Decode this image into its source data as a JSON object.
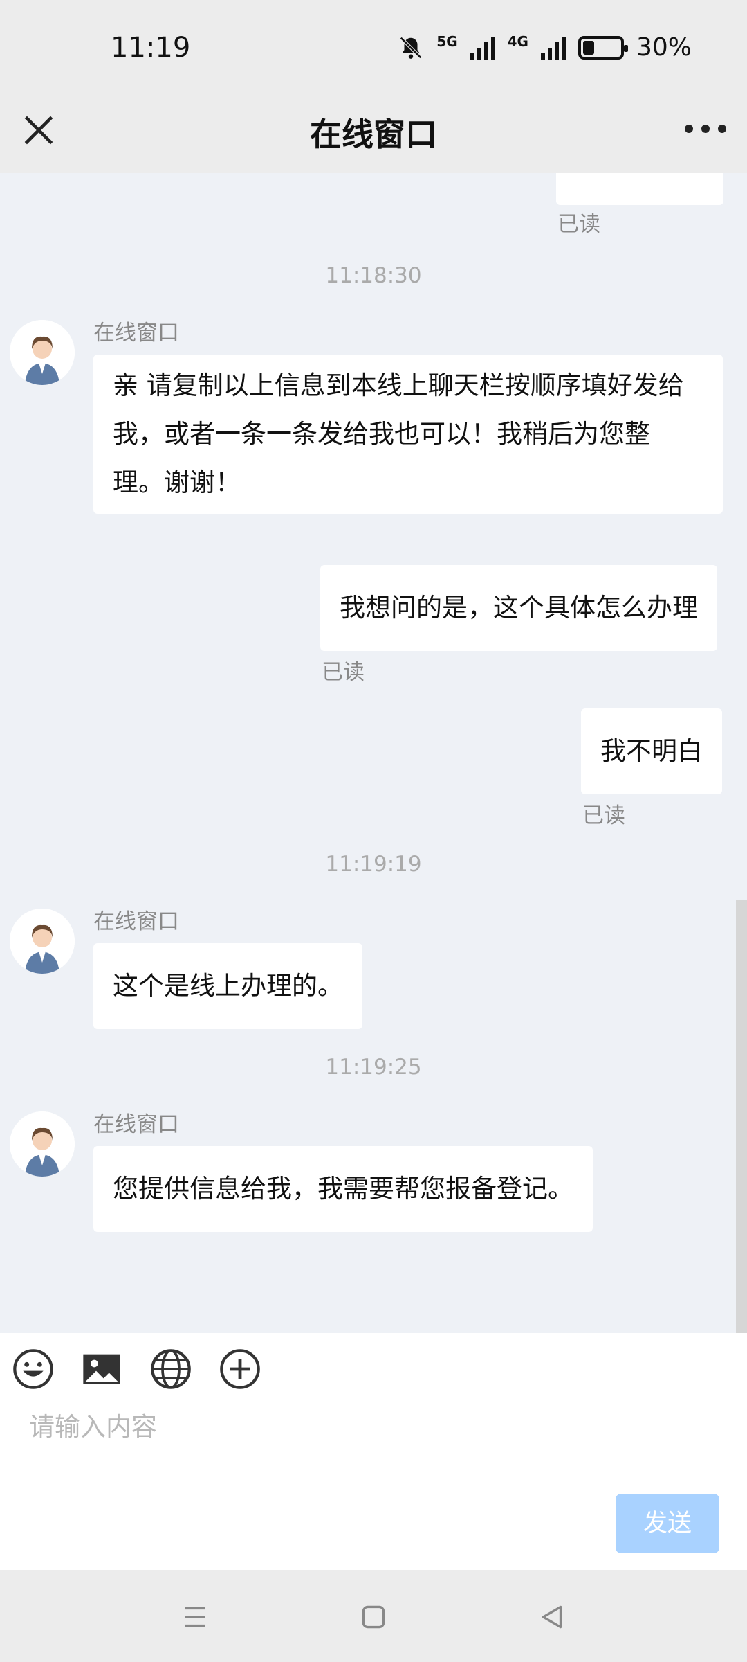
{
  "status": {
    "time": "11:19",
    "network1": "5G",
    "network2": "4G",
    "battery": "30%",
    "battery_level": 0.3
  },
  "header": {
    "title": "在线窗口"
  },
  "messages": {
    "m0_read": "已读",
    "t1": "11:18:30",
    "a1_name": "在线窗口",
    "a1_line1": "亲 请复制以上信息到本线上聊天栏按顺序填好发给",
    "a1_line2": "我，或者一条一条发给我也可以！我稍后为您整",
    "a1_line3": "理。谢谢！",
    "u1": "我想问的是，这个具体怎么办理",
    "u1_read": "已读",
    "u2": "我不明白",
    "u2_read": "已读",
    "t2": "11:19:19",
    "a2_name": "在线窗口",
    "a2": "这个是线上办理的。",
    "t3": "11:19:25",
    "a3_name": "在线窗口",
    "a3": "您提供信息给我，我需要帮您报备登记。"
  },
  "composer": {
    "placeholder": "请输入内容",
    "send_label": "发送"
  },
  "colors": {
    "send_button": "#a9d2ff",
    "background": "#eef1f6",
    "bubble": "#ffffff"
  }
}
